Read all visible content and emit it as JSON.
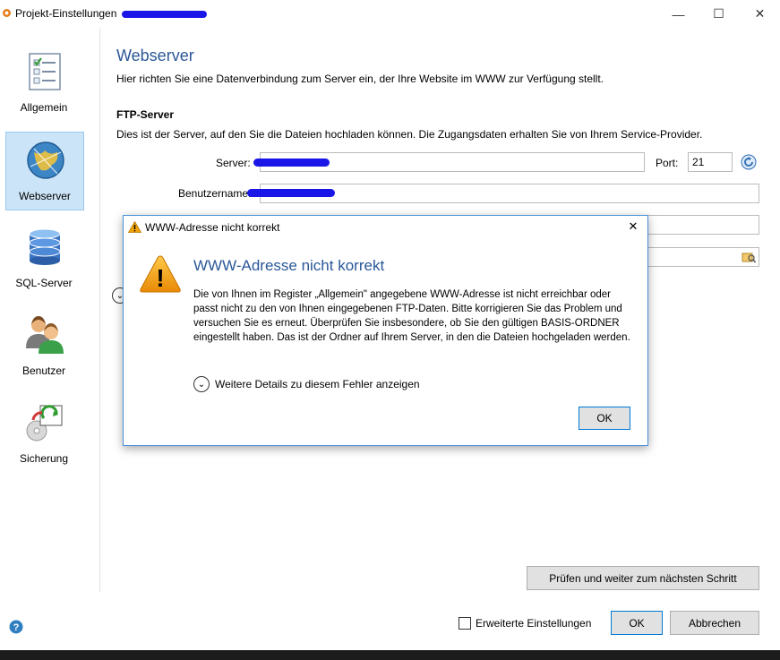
{
  "window": {
    "title": "Projekt-Einstellungen",
    "minimize_glyph": "—",
    "maximize_glyph": "☐",
    "close_glyph": "✕"
  },
  "sidebar": {
    "items": [
      {
        "label": "Allgemein",
        "icon": "checklist-icon"
      },
      {
        "label": "Webserver",
        "icon": "globe-icon"
      },
      {
        "label": "SQL-Server",
        "icon": "database-icon"
      },
      {
        "label": "Benutzer",
        "icon": "users-icon"
      },
      {
        "label": "Sicherung",
        "icon": "backup-icon"
      }
    ],
    "active": "Webserver"
  },
  "main": {
    "title": "Webserver",
    "description": "Hier richten Sie eine Datenverbindung zum Server ein, der Ihre Website im WWW zur Verfügung stellt.",
    "ftp_heading": "FTP-Server",
    "ftp_description": "Dies ist der Server, auf den Sie die Dateien hochladen können. Die Zugangsdaten erhalten Sie von Ihrem Service-Provider.",
    "server_label": "Server:",
    "port_label": "Port:",
    "port_value": "21",
    "username_label": "Benutzername:",
    "check_button": "Prüfen und weiter zum nächsten Schritt"
  },
  "footer": {
    "advanced_label": "Erweiterte Einstellungen",
    "advanced_checked": false,
    "ok_label": "OK",
    "cancel_label": "Abbrechen",
    "help_glyph": "?"
  },
  "dialog": {
    "title": "WWW-Adresse nicht korrekt",
    "heading": "WWW-Adresse nicht korrekt",
    "message": "Die von Ihnen im Register „Allgemein\" angegebene WWW-Adresse ist nicht erreichbar oder passt nicht zu den von Ihnen eingegebenen FTP-Daten. Bitte korrigieren Sie das Problem und versuchen Sie es erneut. Überprüfen Sie insbesondere, ob Sie den gültigen BASIS-ORDNER eingestellt haben. Das ist der Ordner auf Ihrem Server, in den die Dateien hochgeladen werden.",
    "details_label": "Weitere Details zu diesem Fehler anzeigen",
    "ok_label": "OK",
    "close_glyph": "✕",
    "warning_glyph": "!"
  },
  "colors": {
    "accent": "#2a5798",
    "selection": "#cce4f7",
    "warning": "#f0a30a",
    "redaction": "#1a16e8"
  }
}
